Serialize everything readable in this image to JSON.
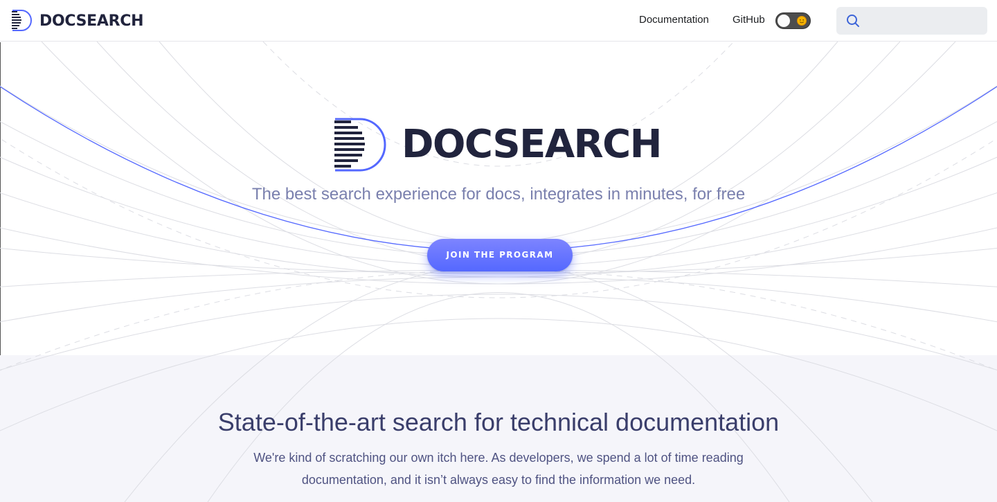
{
  "navbar": {
    "brand": "DOCSEARCH",
    "links": [
      {
        "label": "Documentation"
      },
      {
        "label": "GitHub"
      }
    ],
    "theme_toggle_icon": "sun-icon",
    "search_placeholder": ""
  },
  "hero": {
    "logo_text": "DOCSEARCH",
    "tagline": "The best search experience for docs, integrates in minutes, for free",
    "cta_label": "JOIN THE PROGRAM"
  },
  "feature": {
    "title": "State-of-the-art search for technical documentation",
    "text": "We're kind of scratching our own itch here. As developers, we spend a lot of time reading documentation, and it isn’t always easy to find the information we need."
  },
  "colors": {
    "accent": "#5468ff",
    "brand_dark": "#21243d",
    "tagline": "#7a80ae",
    "feature_bg": "#f5f5fa"
  }
}
